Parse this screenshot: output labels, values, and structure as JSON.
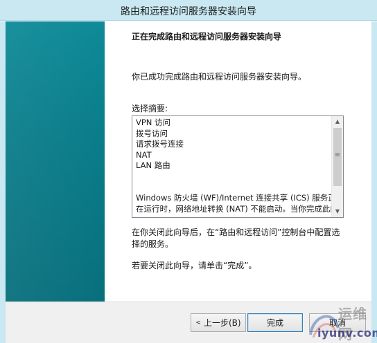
{
  "window": {
    "title": "路由和远程访问服务器安装向导"
  },
  "content": {
    "heading": "正在完成路由和远程访问服务器安装向导",
    "intro": "你已成功完成路由和远程访问服务器安装向导。",
    "summary_label": "选择摘要:",
    "summary_items": [
      "VPN 访问",
      "拨号访问",
      "请求拨号连接",
      "NAT",
      "LAN 路由"
    ],
    "summary_note_1": "Windows 防火墙 (WF)/Internet 连接共享 (ICS) 服务正",
    "summary_note_2": "在运行时，网络地址转换 (NAT) 不能启动。当你完成此向",
    "after_close": "在你关闭此向导后，在“路由和远程访问”控制台中配置选择的服务。",
    "finish_hint": "若要关闭此向导，请单击“完成”。"
  },
  "buttons": {
    "back": "上一步(B)",
    "finish": "完成",
    "cancel": "取消"
  },
  "watermark": {
    "brand": "运维网",
    "domain": "iyunv.com"
  },
  "icons": {
    "back_arrow": "triangle-left-icon",
    "scroll_up": "scroll-up-arrow-icon",
    "scroll_down": "scroll-down-arrow-icon",
    "scroll_grip": "scroll-grip-icon"
  },
  "colors": {
    "titlebar": "#c9e8f2",
    "side_panel": "#0a7d8a",
    "button_bar": "#f0f0f0"
  }
}
